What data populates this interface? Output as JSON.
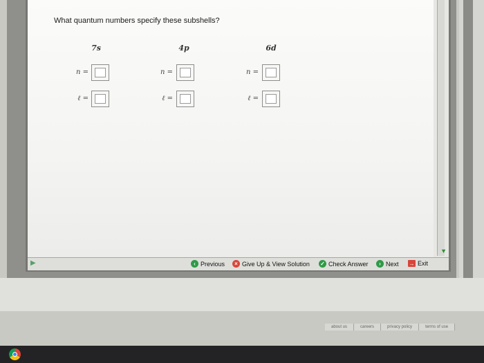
{
  "question": {
    "prompt": "What quantum numbers specify these subshells?",
    "columns": [
      {
        "subshell": "7s",
        "n_label": "n =",
        "l_label": "ℓ =",
        "n_value": "",
        "l_value": ""
      },
      {
        "subshell": "4p",
        "n_label": "n =",
        "l_label": "ℓ =",
        "n_value": "",
        "l_value": ""
      },
      {
        "subshell": "6d",
        "n_label": "n =",
        "l_label": "ℓ =",
        "n_value": "",
        "l_value": ""
      }
    ]
  },
  "toolbar": {
    "previous_label": "Previous",
    "giveup_label": "Give Up & View Solution",
    "check_label": "Check Answer",
    "next_label": "Next",
    "exit_label": "Exit"
  },
  "footer": {
    "links": [
      "about us",
      "careers",
      "privacy policy",
      "terms of use"
    ]
  },
  "colors": {
    "check_icon": "#2f9a47",
    "giveup_icon": "#d9453a",
    "exit_icon": "#d9453a"
  }
}
